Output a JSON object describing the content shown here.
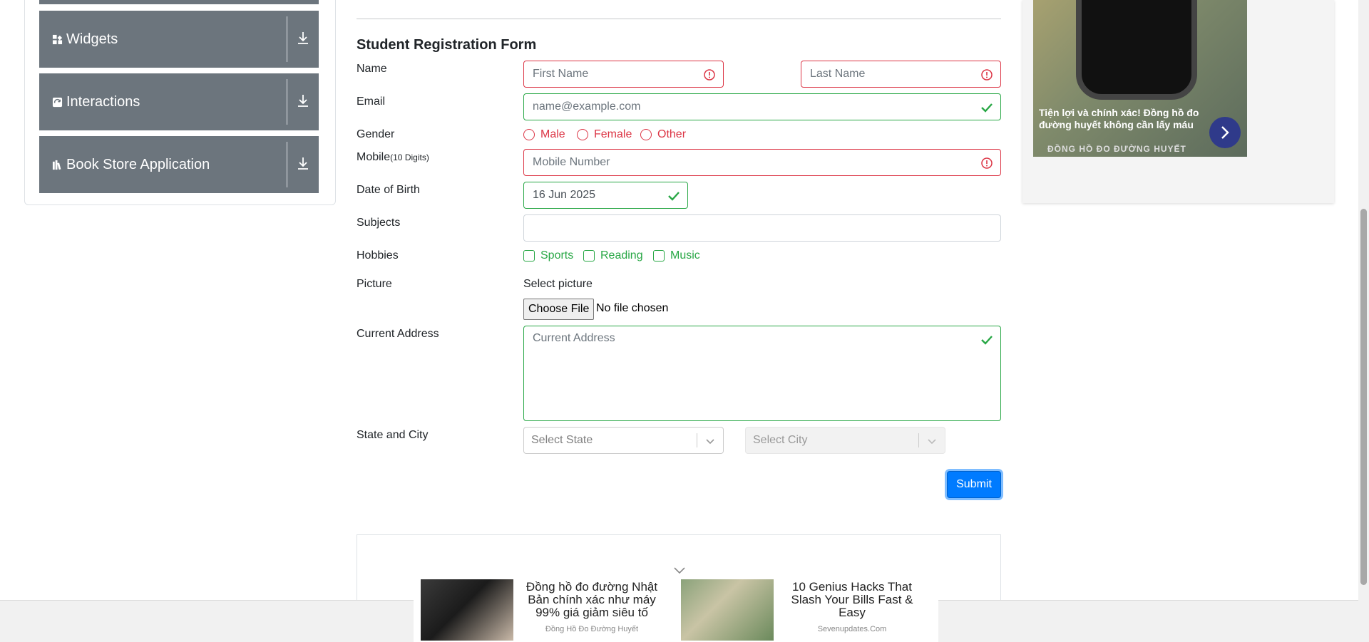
{
  "sidebar": {
    "groups": [
      {
        "label": "Widgets",
        "icon": "widgets-icon"
      },
      {
        "label": "Interactions",
        "icon": "interactions-icon"
      },
      {
        "label": "Book Store Application",
        "icon": "bookstore-icon"
      }
    ]
  },
  "form": {
    "title": "Student Registration Form",
    "labels": {
      "name": "Name",
      "email": "Email",
      "gender": "Gender",
      "mobile": "Mobile",
      "mobile_hint": "(10 Digits)",
      "dob": "Date of Birth",
      "subjects": "Subjects",
      "hobbies": "Hobbies",
      "picture": "Picture",
      "address": "Current Address",
      "state_city": "State and City"
    },
    "first_name_placeholder": "First Name",
    "last_name_placeholder": "Last Name",
    "email_placeholder": "name@example.com",
    "gender_options": [
      "Male",
      "Female",
      "Other"
    ],
    "mobile_placeholder": "Mobile Number",
    "dob_value": "16 Jun 2025",
    "hobbies_options": [
      "Sports",
      "Reading",
      "Music"
    ],
    "select_picture": "Select picture",
    "choose_file": "Choose File",
    "no_file": "No file chosen",
    "address_placeholder": "Current Address",
    "state_placeholder": "Select State",
    "city_placeholder": "Select City",
    "submit": "Submit"
  },
  "ad_right": {
    "text": "Tiện lợi và chính xác! Đồng hồ đo đường huyết không cần lấy máu",
    "brand": "ĐỒNG HỒ ĐO ĐƯỜNG HUYẾT"
  },
  "ad_bottom": [
    {
      "title": "Đồng hồ đo đường Nhật Bản chính xác như máy 99% giá giảm siêu tố",
      "source": "Đồng Hồ Đo Đường Huyết"
    },
    {
      "title": "10 Genius Hacks That Slash Your Bills Fast & Easy",
      "source": "Sevenupdates.Com"
    }
  ],
  "colors": {
    "invalid": "#dc3545",
    "valid": "#28a745",
    "primary": "#007bff",
    "sidebar": "#6c757d"
  }
}
